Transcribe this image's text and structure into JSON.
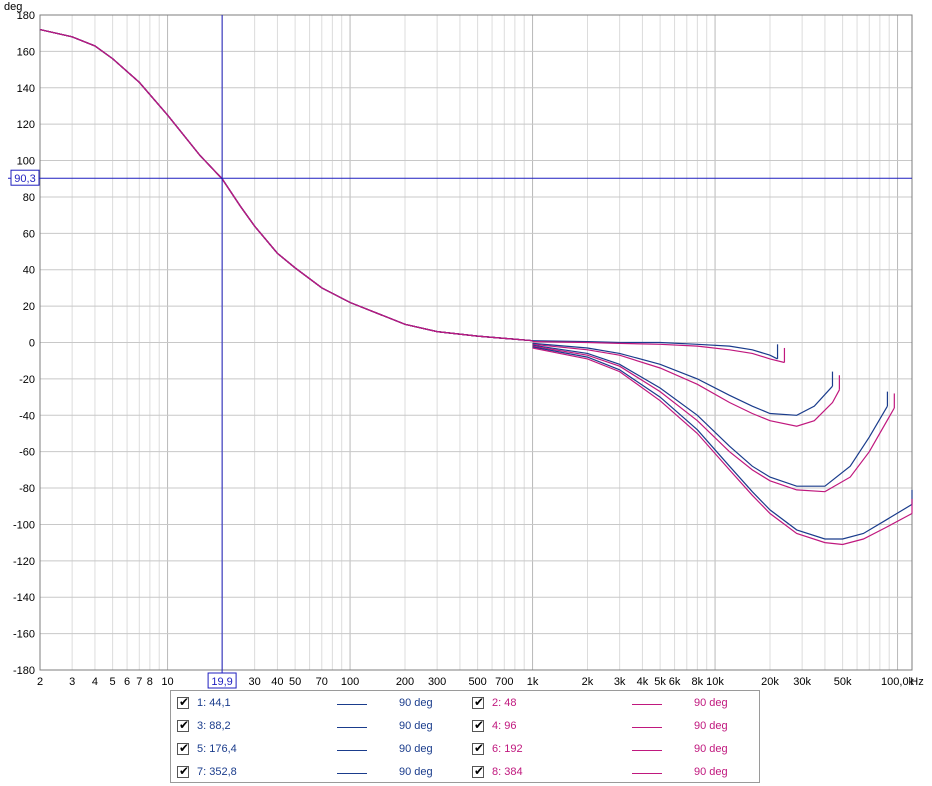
{
  "chart_data": {
    "type": "line",
    "ylabel": "deg",
    "xunit": "Hz",
    "xscale": "log",
    "xlim": [
      2,
      120000
    ],
    "ylim": [
      -180,
      180
    ],
    "yticks": [
      180,
      160,
      140,
      120,
      100,
      80,
      60,
      40,
      20,
      0,
      -20,
      -40,
      -60,
      -80,
      -100,
      -120,
      -140,
      -160,
      -180
    ],
    "xticks": [
      {
        "v": 2,
        "label": "2"
      },
      {
        "v": 3,
        "label": "3"
      },
      {
        "v": 4,
        "label": "4"
      },
      {
        "v": 5,
        "label": "5"
      },
      {
        "v": 6,
        "label": "6"
      },
      {
        "v": 7,
        "label": "7"
      },
      {
        "v": 8,
        "label": "8"
      },
      {
        "v": 10,
        "label": "10"
      },
      {
        "v": 30,
        "label": "30"
      },
      {
        "v": 40,
        "label": "40"
      },
      {
        "v": 50,
        "label": "50"
      },
      {
        "v": 70,
        "label": "70"
      },
      {
        "v": 100,
        "label": "100"
      },
      {
        "v": 200,
        "label": "200"
      },
      {
        "v": 300,
        "label": "300"
      },
      {
        "v": 500,
        "label": "500"
      },
      {
        "v": 700,
        "label": "700"
      },
      {
        "v": 1000,
        "label": "1k"
      },
      {
        "v": 2000,
        "label": "2k"
      },
      {
        "v": 3000,
        "label": "3k"
      },
      {
        "v": 4000,
        "label": "4k"
      },
      {
        "v": 5000,
        "label": "5k"
      },
      {
        "v": 6000,
        "label": "6k"
      },
      {
        "v": 8000,
        "label": "8k"
      },
      {
        "v": 10000,
        "label": "10k"
      },
      {
        "v": 20000,
        "label": "20k"
      },
      {
        "v": 30000,
        "label": "30k"
      },
      {
        "v": 50000,
        "label": "50k"
      },
      {
        "v": 100000,
        "label": "100,0k"
      }
    ],
    "cursor": {
      "x": 19.9,
      "y": 90.3,
      "x_label": "19,9",
      "y_label": "90,3"
    },
    "grid": true,
    "common_curve": {
      "x": [
        2,
        3,
        4,
        5,
        7,
        10,
        15,
        19.9,
        25,
        30,
        40,
        50,
        70,
        100,
        200,
        300,
        500,
        1000
      ],
      "y": [
        172,
        168,
        163,
        156,
        143,
        125,
        103,
        90,
        75,
        64,
        49,
        41,
        30,
        22,
        10,
        6,
        3.5,
        1
      ]
    },
    "series": [
      {
        "name": "1: 44,1",
        "color": "#1a3c8c",
        "x": [
          1000,
          2000,
          3000,
          5000,
          8000,
          12000,
          16000,
          20000,
          22000
        ],
        "y": [
          1,
          0.5,
          0,
          0,
          -1,
          -2,
          -4,
          -7,
          -9
        ]
      },
      {
        "name": "2: 48",
        "color": "#c0187e",
        "x": [
          1000,
          2000,
          3000,
          5000,
          8000,
          12000,
          16000,
          20000,
          24000
        ],
        "y": [
          0.5,
          0,
          -0.5,
          -1,
          -2,
          -4,
          -6,
          -9,
          -11
        ]
      },
      {
        "name": "3: 88,2",
        "color": "#1a3c8c",
        "x": [
          1000,
          2000,
          3000,
          5000,
          8000,
          12000,
          16000,
          20000,
          28000,
          35000,
          44000
        ],
        "y": [
          -0.5,
          -3,
          -6,
          -12,
          -20,
          -29,
          -35,
          -39,
          -40,
          -35,
          -24
        ]
      },
      {
        "name": "4: 96",
        "color": "#c0187e",
        "x": [
          1000,
          2000,
          3000,
          5000,
          8000,
          12000,
          16000,
          20000,
          28000,
          35000,
          44000,
          48000
        ],
        "y": [
          -1,
          -4,
          -7,
          -14,
          -23,
          -33,
          -39,
          -43,
          -46,
          -43,
          -33,
          -26
        ]
      },
      {
        "name": "5: 176,4",
        "color": "#1a3c8c",
        "x": [
          1000,
          2000,
          3000,
          5000,
          8000,
          12000,
          16000,
          20000,
          28000,
          40000,
          55000,
          70000,
          88000
        ],
        "y": [
          -1.5,
          -6,
          -12,
          -25,
          -40,
          -57,
          -68,
          -74,
          -79,
          -79,
          -68,
          -52,
          -35
        ]
      },
      {
        "name": "6: 192",
        "color": "#c0187e",
        "x": [
          1000,
          2000,
          3000,
          5000,
          8000,
          12000,
          16000,
          20000,
          28000,
          40000,
          55000,
          70000,
          96000
        ],
        "y": [
          -2,
          -7,
          -13,
          -27,
          -43,
          -60,
          -70,
          -76,
          -81,
          -82,
          -74,
          -60,
          -36
        ]
      },
      {
        "name": "7: 352,8",
        "color": "#1a3c8c",
        "x": [
          1000,
          2000,
          3000,
          5000,
          8000,
          12000,
          16000,
          20000,
          28000,
          40000,
          50000,
          65000,
          85000,
          120000
        ],
        "y": [
          -2.5,
          -8,
          -15,
          -30,
          -48,
          -68,
          -82,
          -92,
          -103,
          -108,
          -108,
          -105,
          -98,
          -89
        ]
      },
      {
        "name": "8: 384",
        "color": "#c0187e",
        "x": [
          1000,
          2000,
          3000,
          5000,
          8000,
          12000,
          16000,
          20000,
          28000,
          40000,
          50000,
          65000,
          85000,
          120000
        ],
        "y": [
          -3,
          -9,
          -16,
          -32,
          -50,
          -70,
          -84,
          -94,
          -105,
          -110,
          -111,
          -108,
          -102,
          -94
        ]
      }
    ]
  },
  "legend": {
    "rows": [
      [
        {
          "label": "1: 44,1",
          "value": "90 deg",
          "color": "#1a3c8c"
        },
        {
          "label": "2: 48",
          "value": "90 deg",
          "color": "#c0187e"
        }
      ],
      [
        {
          "label": "3: 88,2",
          "value": "90 deg",
          "color": "#1a3c8c"
        },
        {
          "label": "4: 96",
          "value": "90 deg",
          "color": "#c0187e"
        }
      ],
      [
        {
          "label": "5: 176,4",
          "value": "90 deg",
          "color": "#1a3c8c"
        },
        {
          "label": "6: 192",
          "value": "90 deg",
          "color": "#c0187e"
        }
      ],
      [
        {
          "label": "7: 352,8",
          "value": "90 deg",
          "color": "#1a3c8c"
        },
        {
          "label": "8: 384",
          "value": "90 deg",
          "color": "#c0187e"
        }
      ]
    ]
  }
}
